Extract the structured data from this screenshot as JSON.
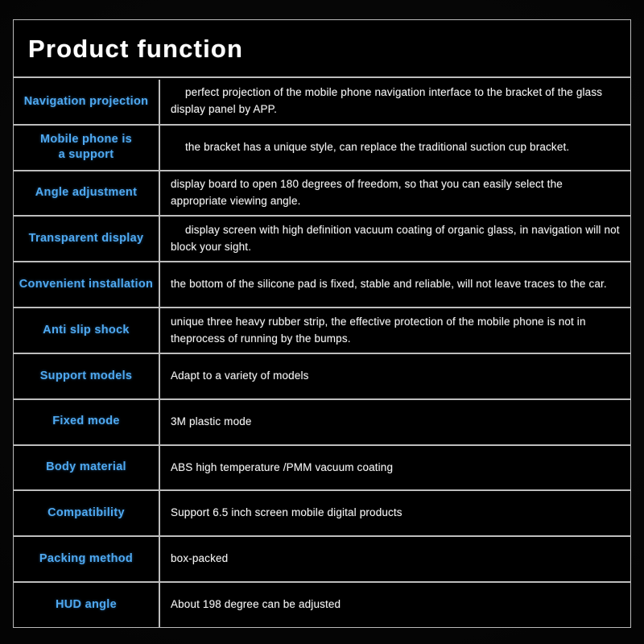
{
  "document": {
    "title": "Product function",
    "accent_color": "#4fa9f0",
    "text_color": "#f2f2f2",
    "border_color": "#bdbdbd",
    "background_color": "#000000"
  },
  "spec_table": {
    "rows": [
      {
        "label": "Navigation projection",
        "description": "perfect projection of the mobile phone navigation interface to the bracket of the glass display panel by APP.",
        "indented": true
      },
      {
        "label": "Mobile phone is\na support",
        "description": "the bracket has a unique style, can replace the traditional suction cup bracket.",
        "indented": true
      },
      {
        "label": "Angle adjustment",
        "description": "display board to open 180 degrees of freedom, so that you can easily select the appropriate viewing angle.",
        "indented": false
      },
      {
        "label": "Transparent display",
        "description": "display screen with high definition vacuum coating of organic glass, in navigation will not block your sight.",
        "indented": true
      },
      {
        "label": "Convenient installation",
        "description": "the bottom of the silicone pad is fixed, stable and reliable, will not leave traces to the car.",
        "indented": false
      },
      {
        "label": "Anti slip shock",
        "description": "unique three heavy rubber strip, the effective protection of the mobile phone is not in theprocess of running by the bumps.",
        "indented": false
      },
      {
        "label": "Support models",
        "description": "Adapt to a variety of models",
        "indented": false
      },
      {
        "label": "Fixed mode",
        "description": "3M plastic mode",
        "indented": false
      },
      {
        "label": "Body material",
        "description": "ABS high temperature /PMM vacuum coating",
        "indented": false
      },
      {
        "label": "Compatibility",
        "description": "Support 6.5 inch screen mobile digital products",
        "indented": false
      },
      {
        "label": "Packing method",
        "description": "box-packed",
        "indented": false
      },
      {
        "label": "HUD angle",
        "description": "About 198 degree can be adjusted",
        "indented": false
      }
    ]
  }
}
